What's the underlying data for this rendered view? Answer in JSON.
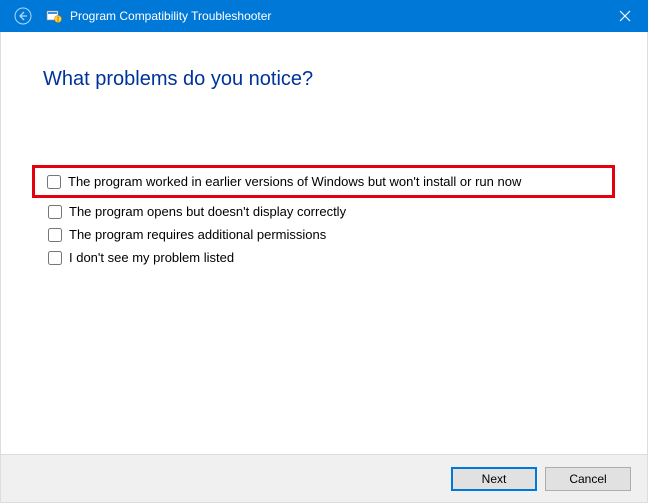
{
  "titlebar": {
    "title": "Program Compatibility Troubleshooter"
  },
  "heading": "What problems do you notice?",
  "options": [
    {
      "label": "The program worked in earlier versions of Windows but won't install or run now",
      "highlighted": true
    },
    {
      "label": "The program opens but doesn't display correctly",
      "highlighted": false
    },
    {
      "label": "The program requires additional permissions",
      "highlighted": false
    },
    {
      "label": "I don't see my problem listed",
      "highlighted": false
    }
  ],
  "footer": {
    "next_label": "Next",
    "cancel_label": "Cancel"
  }
}
